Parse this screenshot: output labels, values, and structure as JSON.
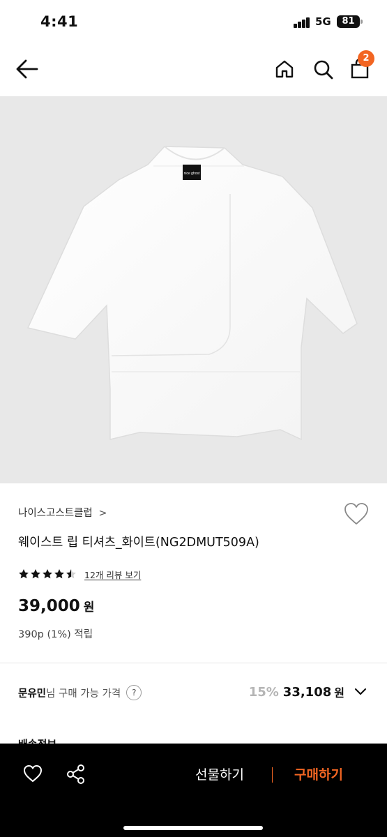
{
  "status_bar": {
    "time": "4:41",
    "network": "5G",
    "battery": "81"
  },
  "header": {
    "back_icon": "arrow-left-icon",
    "home_icon": "home-icon",
    "search_icon": "search-icon",
    "cart_icon": "shopping-bag-icon",
    "cart_count": "2"
  },
  "product": {
    "image_alt": "white t-shirt",
    "image_logo_text": "nice ghost",
    "brand": "나이스고스트클럽",
    "brand_chevron": ">",
    "title": "웨이스트 립 티셔츠_화이트(NG2DMUT509A)",
    "rating": 4.5,
    "review_link": "12개 리뷰 보기",
    "price": "39,000",
    "price_unit": "원",
    "points": "390p (1%) 적립"
  },
  "member_price": {
    "name": "문유민",
    "label": "님 구매 가능 가격",
    "help": "?",
    "discount": "15%",
    "price": "33,108",
    "unit": "원"
  },
  "shipping_peek": "배송정보",
  "bottom_bar": {
    "gift": "선물하기",
    "buy": "구매하기"
  },
  "colors": {
    "accent": "#f26522",
    "bar": "#000000"
  }
}
